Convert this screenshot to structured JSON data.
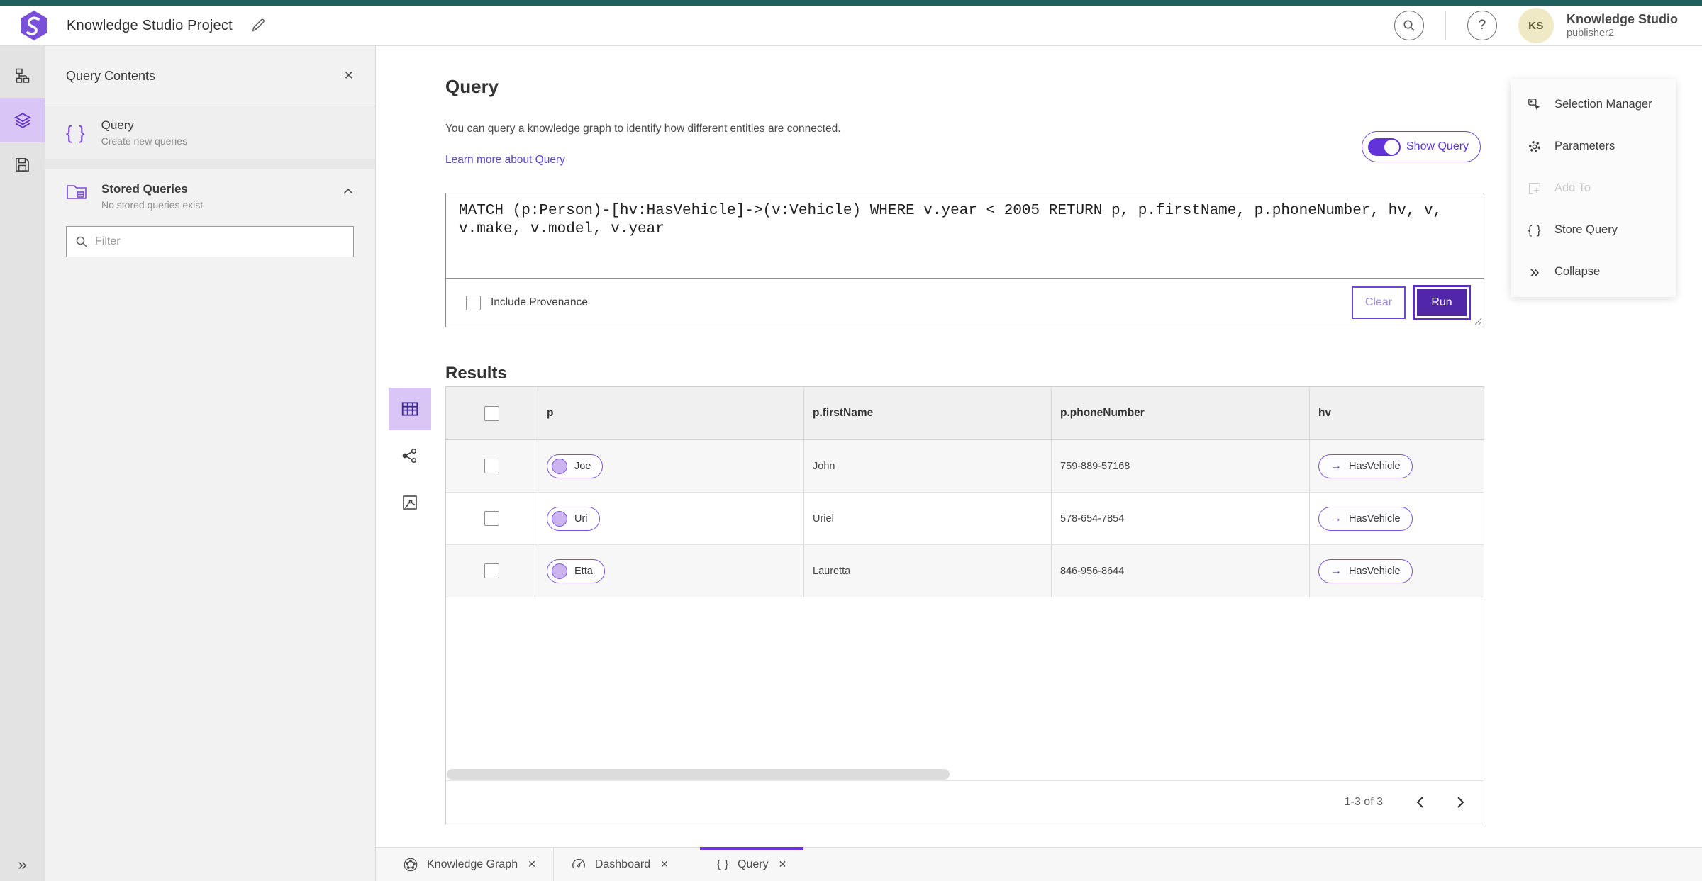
{
  "header": {
    "title": "Knowledge Studio Project",
    "app_name": "Knowledge Studio",
    "user_name": "publisher2",
    "avatar_initials": "KS",
    "help_glyph": "?"
  },
  "left_rail": {
    "items": [
      {
        "icon": "schema-icon",
        "active": false
      },
      {
        "icon": "layers-icon",
        "active": true
      },
      {
        "icon": "save-icon",
        "active": false
      }
    ],
    "expand_glyph": "»"
  },
  "sidebar": {
    "title": "Query Contents",
    "close_glyph": "✕",
    "query_item": {
      "icon": "curly-braces-icon",
      "icon_glyph": "{ }",
      "title": "Query",
      "subtitle": "Create new queries"
    },
    "stored_queries": {
      "icon": "stored-folder-icon",
      "title": "Stored Queries",
      "subtitle": "No stored queries exist"
    },
    "filter_placeholder": "Filter"
  },
  "query_panel": {
    "title": "Query",
    "description": "You can query a knowledge graph to identify how different entities are connected.",
    "learn_more": "Learn more about Query",
    "show_query_label": "Show Query",
    "show_query_on": true,
    "query_text": "MATCH (p:Person)-[hv:HasVehicle]->(v:Vehicle) WHERE v.year < 2005 RETURN p, p.firstName, p.phoneNumber, hv, v, v.make, v.model, v.year",
    "include_provenance_label": "Include Provenance",
    "include_provenance_checked": false,
    "clear_label": "Clear",
    "run_label": "Run"
  },
  "results": {
    "title": "Results",
    "view_modes": [
      "table-view",
      "graph-view",
      "chart-view"
    ],
    "active_view": "table-view",
    "columns": [
      "p",
      "p.firstName",
      "p.phoneNumber",
      "hv"
    ],
    "rows": [
      {
        "p": "Joe",
        "firstName": "John",
        "phoneNumber": "759-889-57168",
        "hv": "HasVehicle"
      },
      {
        "p": "Uri",
        "firstName": "Uriel",
        "phoneNumber": "578-654-7854",
        "hv": "HasVehicle"
      },
      {
        "p": "Etta",
        "firstName": "Lauretta",
        "phoneNumber": "846-956-8644",
        "hv": "HasVehicle"
      }
    ],
    "edge_arrow_glyph": "→",
    "pagination": {
      "label": "1-3 of 3"
    }
  },
  "right_panel": {
    "items": [
      {
        "icon": "selection-manager-icon",
        "label": "Selection Manager",
        "disabled": false
      },
      {
        "icon": "gear-icon",
        "label": "Parameters",
        "disabled": false
      },
      {
        "icon": "add-to-icon",
        "label": "Add To",
        "disabled": true
      },
      {
        "icon": "curly-braces-icon",
        "label": "Store Query",
        "disabled": false,
        "icon_glyph": "{ }"
      },
      {
        "icon": "collapse-icon",
        "label": "Collapse",
        "disabled": false,
        "icon_glyph": "»"
      }
    ]
  },
  "bottom_tabs": [
    {
      "icon": "knowledge-graph-icon",
      "label": "Knowledge Graph",
      "close_glyph": "✕",
      "active": false
    },
    {
      "icon": "dashboard-icon",
      "label": "Dashboard",
      "close_glyph": "✕",
      "active": false
    },
    {
      "icon": "curly-braces-icon",
      "label": "Query",
      "close_glyph": "✕",
      "active": true,
      "icon_glyph": "{ }"
    }
  ],
  "colors": {
    "accent_purple": "#6b3bd4",
    "deep_purple_run": "#5126a9",
    "light_purple_bg": "#d9c6f7",
    "node_fill": "#cbb4f0",
    "link": "#5b45d6",
    "teal_top": "#215f5e",
    "avatar_bg": "#efe9c5"
  }
}
